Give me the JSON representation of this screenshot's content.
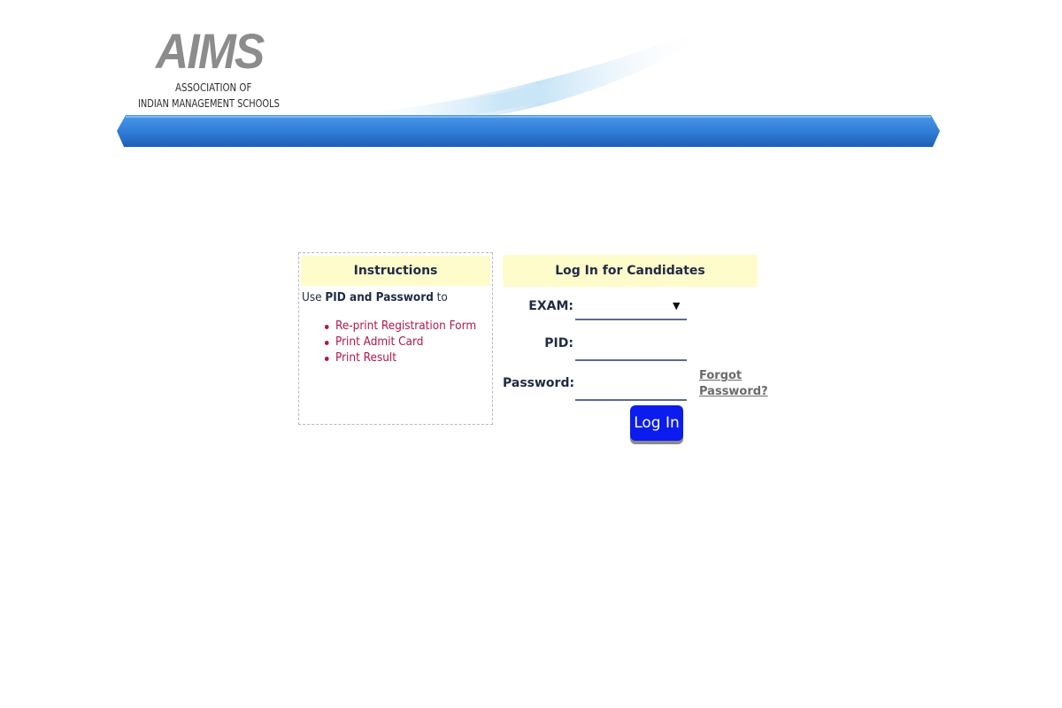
{
  "header": {
    "logo_word": "AIMS",
    "logo_line1": "ASSOCIATION OF",
    "logo_line2": "INDIAN MANAGEMENT SCHOOLS"
  },
  "instructions": {
    "title": "Instructions",
    "intro_prefix": "Use ",
    "intro_bold": "PID and Password",
    "intro_suffix": " to",
    "items": [
      {
        "label": "Re-print Registration Form"
      },
      {
        "label": "Print Admit Card"
      },
      {
        "label": "Print Result"
      }
    ]
  },
  "login": {
    "title": "Log In for Candidates",
    "exam_label": "EXAM:",
    "exam_value": "",
    "pid_label": "PID:",
    "pid_value": "",
    "password_label": "Password:",
    "password_value": "",
    "forgot_line1": "Forgot",
    "forgot_line2": "Password?",
    "button_label": "Log In"
  },
  "colors": {
    "header_bar": "#3a86dd",
    "panel_header_bg": "#fffccc",
    "link_red": "#b0174a",
    "button_blue": "#0b1cef"
  }
}
